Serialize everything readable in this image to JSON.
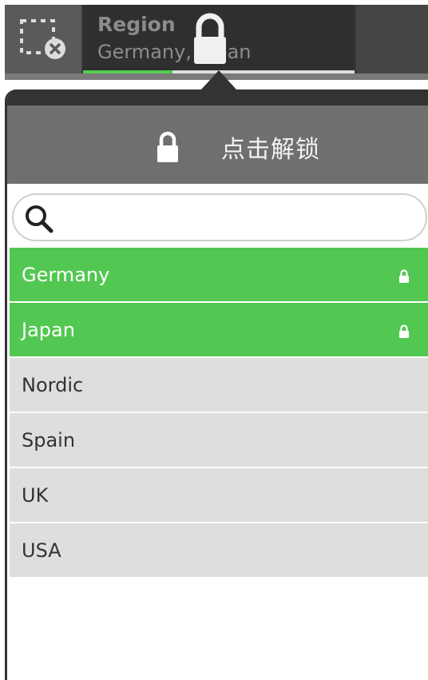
{
  "selection_bar": {
    "clear_icon": "clear-selections-icon",
    "field": {
      "title": "Region",
      "values": "Germany, Japan",
      "locked": true,
      "selected_fraction": 0.33
    }
  },
  "popover": {
    "unlock": {
      "label": "点击解锁",
      "icon": "lock-icon"
    },
    "search": {
      "placeholder": "",
      "value": ""
    },
    "items": [
      {
        "label": "Germany",
        "state": "selected-locked"
      },
      {
        "label": "Japan",
        "state": "selected-locked"
      },
      {
        "label": "Nordic",
        "state": "alternative"
      },
      {
        "label": "Spain",
        "state": "alternative"
      },
      {
        "label": "UK",
        "state": "alternative"
      },
      {
        "label": "USA",
        "state": "alternative"
      }
    ]
  },
  "colors": {
    "selected": "#52c752",
    "alternative": "#dedede",
    "header": "#6f6f6f",
    "bar": "#3a3a3a"
  }
}
